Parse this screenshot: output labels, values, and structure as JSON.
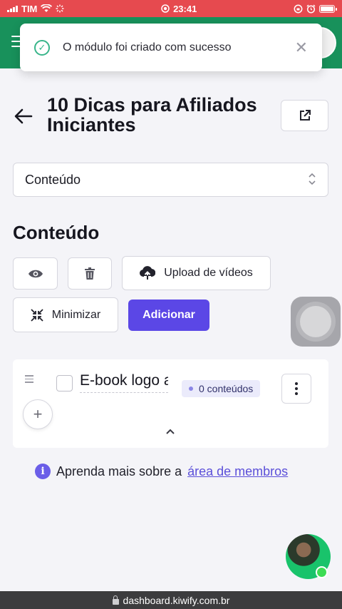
{
  "status_bar": {
    "carrier": "TIM",
    "time": "23:41"
  },
  "toast": {
    "message": "O módulo foi criado com sucesso",
    "icon": "check-circle-icon",
    "close_glyph": "✕"
  },
  "page": {
    "title": "10 Dicas para Afiliados Iniciantes"
  },
  "section_select": {
    "value": "Conteúdo"
  },
  "content": {
    "section_title": "Conteúdo",
    "upload_label": "Upload de vídeos",
    "minimize_label": "Minimizar",
    "add_label": "Adicionar"
  },
  "module": {
    "name": "E-book logo a",
    "count_label": "0 conteúdos"
  },
  "info": {
    "text": "Aprenda mais sobre a",
    "link": "área de membros"
  },
  "browser": {
    "url": "dashboard.kiwify.com.br"
  },
  "colors": {
    "status_bar": "#e64a4f",
    "header": "#18915b",
    "primary": "#5b47e6",
    "success": "#38b58a"
  }
}
